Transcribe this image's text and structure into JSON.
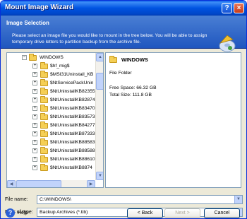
{
  "window": {
    "title": "Mount Image Wizard"
  },
  "header": {
    "title": "Image Selection",
    "description": "Please select an image file you would like to mount in the tree below. You will be able to assign temporary drive letters to partition backup from the archive file."
  },
  "tree": {
    "items": [
      {
        "label": "WINDOWS",
        "expander": "−"
      },
      {
        "label": "$hf_mig$",
        "expander": "+"
      },
      {
        "label": "$MSI31Uninstall_KB",
        "expander": "+"
      },
      {
        "label": "$NtServicePackUnin",
        "expander": "+"
      },
      {
        "label": "$NtUninstallKB82355",
        "expander": "+"
      },
      {
        "label": "$NtUninstallKB82874",
        "expander": "+"
      },
      {
        "label": "$NtUninstallKB83470",
        "expander": "+"
      },
      {
        "label": "$NtUninstallKB83573",
        "expander": "+"
      },
      {
        "label": "$NtUninstallKB84277",
        "expander": "+"
      },
      {
        "label": "$NtUninstallKB87333",
        "expander": "+"
      },
      {
        "label": "$NtUninstallKB88583",
        "expander": "+"
      },
      {
        "label": "$NtUninstallKB88588",
        "expander": "+"
      },
      {
        "label": "$NtUninstallKB88610",
        "expander": "+"
      },
      {
        "label": "$NtUninstallKB8874",
        "expander": "+"
      }
    ]
  },
  "info": {
    "name": "WINDOWS",
    "type": "File Folder",
    "free_space": "Free Space: 66.32 GB",
    "total_size": "Total Size: 111.8 GB"
  },
  "file_name": {
    "label": "File name:",
    "value": "C:\\WINDOWS\\"
  },
  "file_type": {
    "label": "Files of type:",
    "value": "Backup Archives (*.tib)"
  },
  "buttons": {
    "help": "Help",
    "back": "< Back",
    "next": "Next >",
    "cancel": "Cancel"
  },
  "colors": {
    "title_bar": "#0053e1",
    "header": "#2a63c9",
    "window_bg": "#ece9d8"
  }
}
